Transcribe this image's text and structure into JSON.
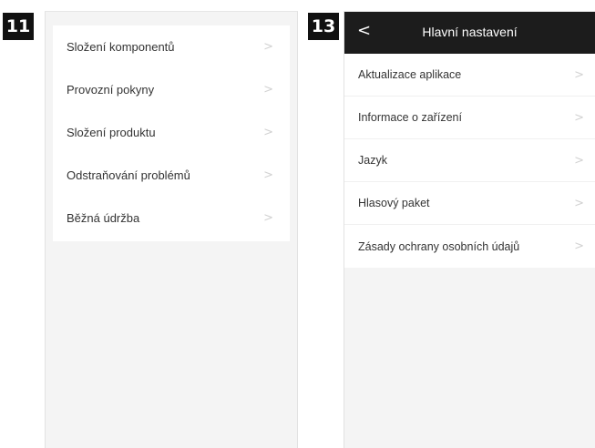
{
  "left_panel": {
    "badge": "11",
    "items": [
      {
        "label": "Složení komponentů",
        "chevron": ">"
      },
      {
        "label": "Provozní pokyny",
        "chevron": ">"
      },
      {
        "label": "Složení produktu",
        "chevron": ">"
      },
      {
        "label": "Odstraňování problémů",
        "chevron": ">"
      },
      {
        "label": "Běžná údržba",
        "chevron": ">"
      }
    ]
  },
  "right_panel": {
    "badge": "13",
    "header": {
      "back_icon": "<",
      "title": "Hlavní nastavení"
    },
    "items": [
      {
        "label": "Aktualizace aplikace",
        "chevron": ">"
      },
      {
        "label": "Informace o zařízení",
        "chevron": ">"
      },
      {
        "label": "Jazyk",
        "chevron": ">"
      },
      {
        "label": "Hlasový paket",
        "chevron": ">"
      },
      {
        "label": "Zásady ochrany osobních údajů",
        "chevron": ">"
      }
    ]
  }
}
